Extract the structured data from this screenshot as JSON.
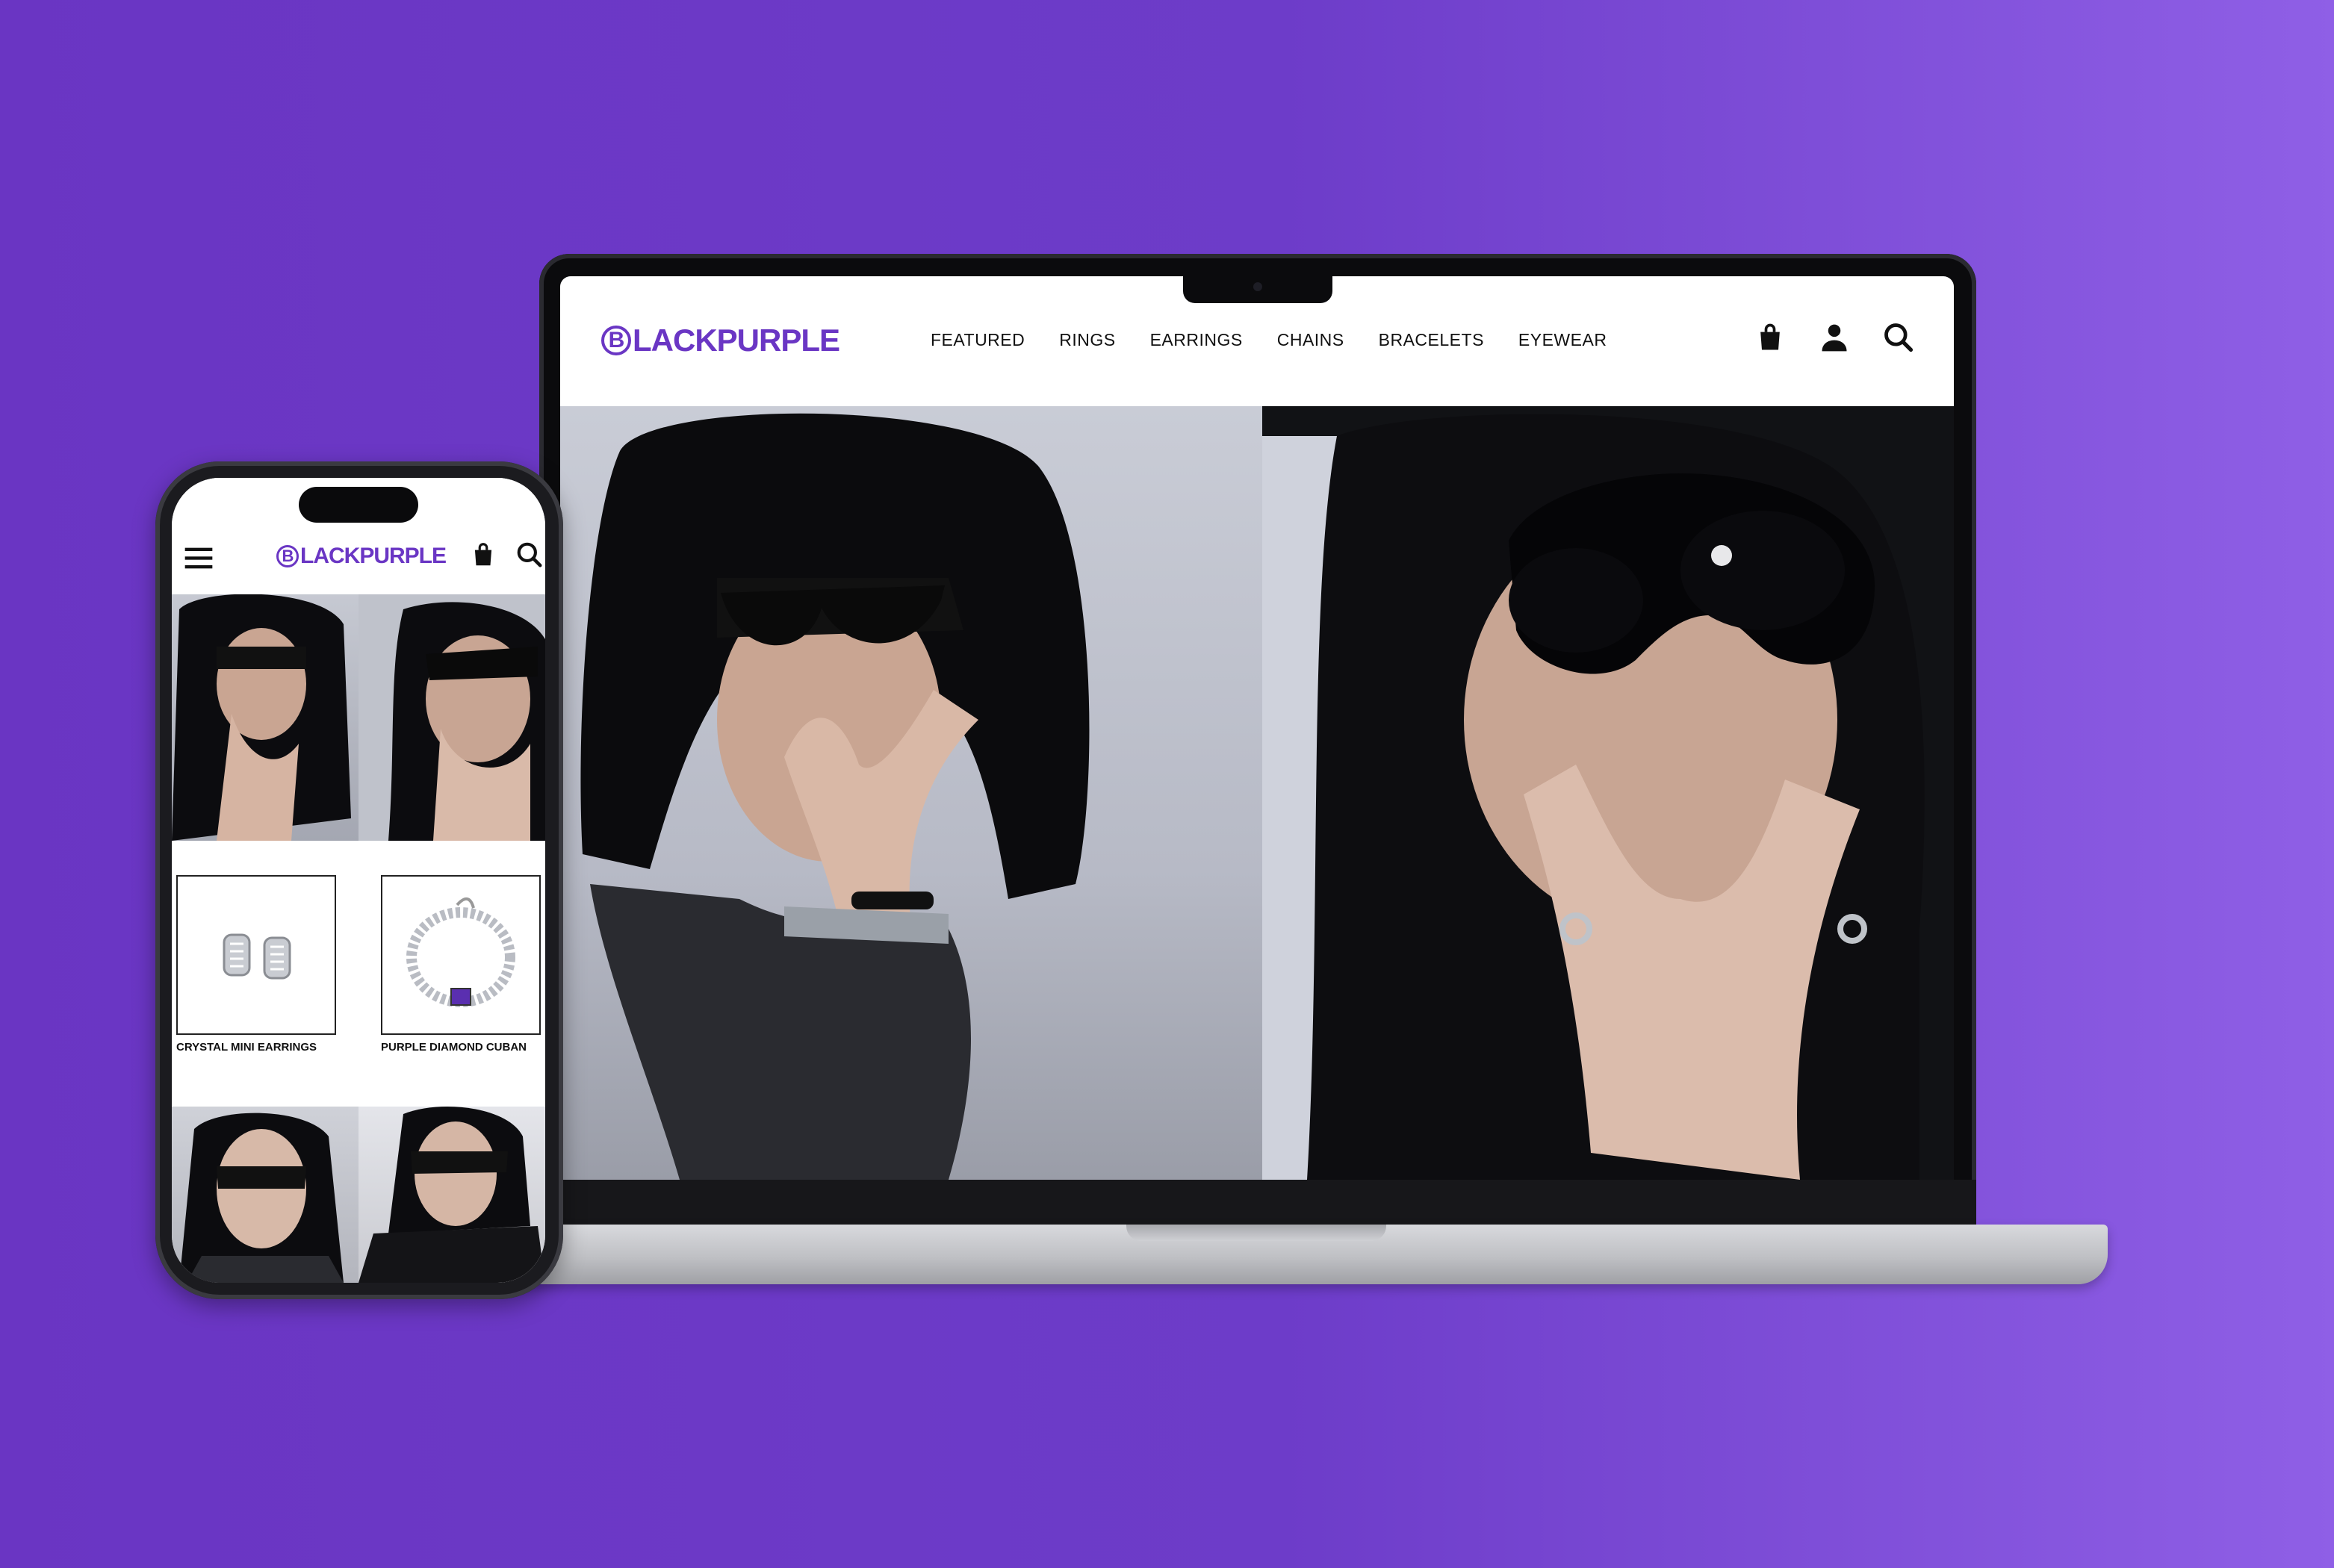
{
  "brand": {
    "name": "BLACKPURPLE",
    "logo_letter": "B",
    "logo_rest": "LACKPURPLE",
    "color": "#6a36c4"
  },
  "desktop": {
    "nav": [
      {
        "label": "FEATURED"
      },
      {
        "label": "RINGS"
      },
      {
        "label": "EARRINGS"
      },
      {
        "label": "CHAINS"
      },
      {
        "label": "BRACELETS"
      },
      {
        "label": "EYEWEAR"
      }
    ],
    "icons": [
      "shopping-bag-icon",
      "user-icon",
      "search-icon"
    ]
  },
  "mobile": {
    "icons": [
      "menu-icon",
      "shopping-bag-icon",
      "search-icon"
    ],
    "products": [
      {
        "name": "CRYSTAL MINI EARRINGS"
      },
      {
        "name": "PURPLE DIAMOND CUBAN"
      }
    ]
  },
  "colors": {
    "background_start": "#6a35c3",
    "background_end": "#8f5fe6",
    "brand": "#6a36c4"
  }
}
